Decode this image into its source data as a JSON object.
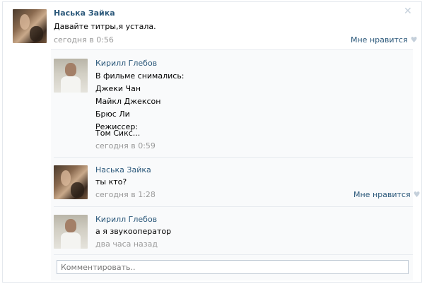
{
  "post": {
    "author": "Наська Зайка",
    "text": "Давайте титры,я устала.",
    "time": "сегодня в 0:56",
    "like_label": "Мне нравится"
  },
  "comments": [
    {
      "author": "Кирилл Глебов",
      "lines": [
        "В фильме снимались:",
        "Джеки Чан",
        "Майкл Джексон",
        "Брюс Ли",
        "Режиссер:",
        "Том Сикс..."
      ],
      "time": "сегодня в 0:59"
    },
    {
      "author": "Наська Зайка",
      "lines": [
        "ты кто?"
      ],
      "time": "сегодня в 1:28",
      "like_label": "Мне нравится"
    },
    {
      "author": "Кирилл Глебов",
      "lines": [
        "а я звукооператор"
      ],
      "time": "два часа назад"
    }
  ],
  "comment_input": {
    "placeholder": "Комментировать.."
  },
  "icons": {
    "close": "close-icon",
    "heart": "heart-icon"
  },
  "colors": {
    "link": "#2b587a",
    "meta": "#999999",
    "divider": "#e7ebef"
  }
}
